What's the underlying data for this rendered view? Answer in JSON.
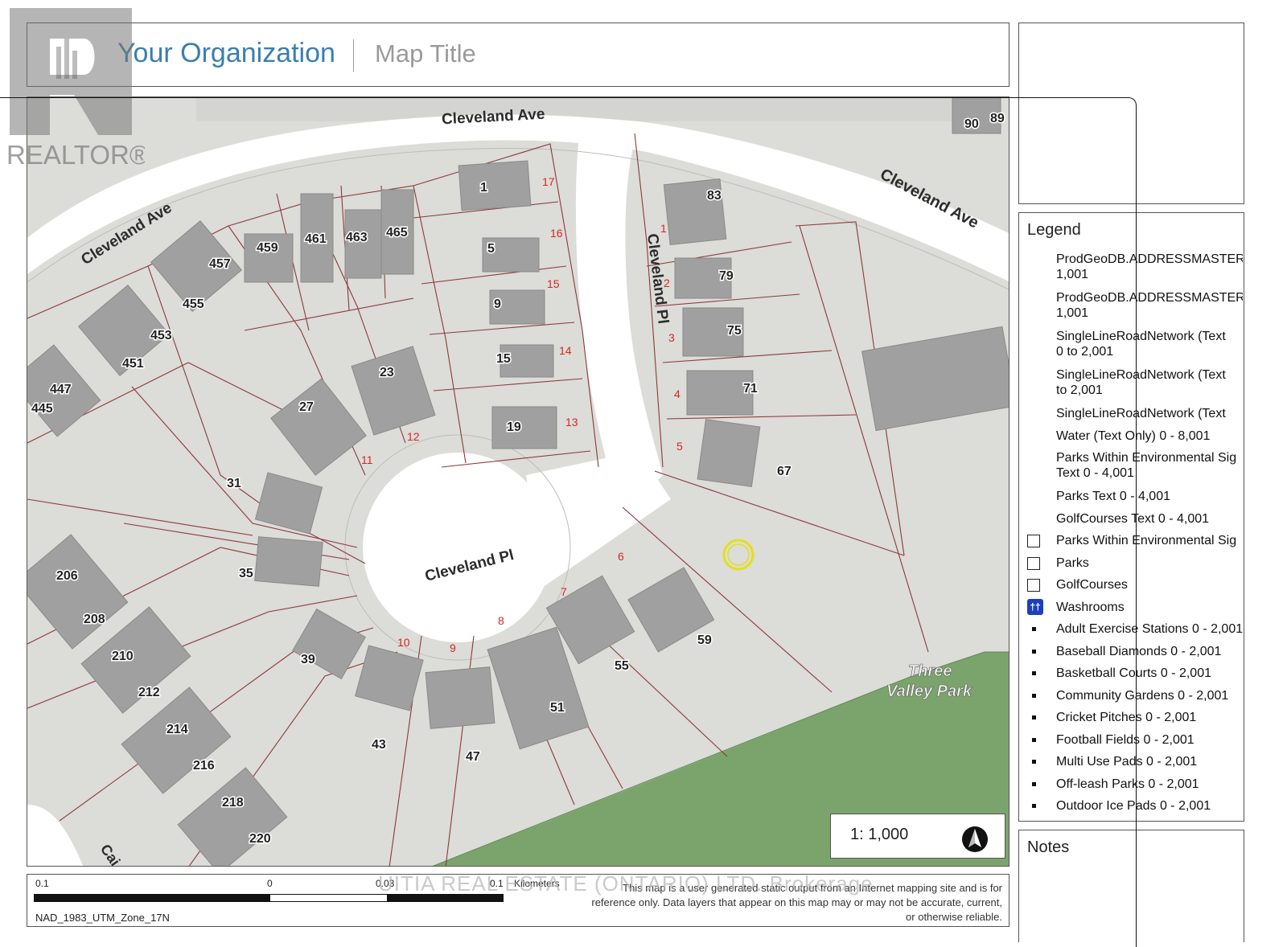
{
  "header": {
    "org_name": "Your Organization",
    "map_title": "Map Title"
  },
  "watermark": {
    "logo_text": "REALTOR®",
    "brokerage": "UITIA REAL ESTATE (ONTARIO) LTD. Brokerage"
  },
  "map": {
    "streets": [
      "Cleveland Ave",
      "Cleveland Ave",
      "Cleveland Ave",
      "Cleveland Pl",
      "Cleveland Pl",
      "Cai"
    ],
    "park_name": [
      "Three",
      "Valley Park"
    ],
    "addresses": [
      "1",
      "5",
      "9",
      "15",
      "19",
      "23",
      "27",
      "31",
      "35",
      "39",
      "43",
      "47",
      "51",
      "55",
      "59",
      "67",
      "71",
      "75",
      "79",
      "83",
      "90",
      "89",
      "206",
      "208",
      "210",
      "212",
      "214",
      "216",
      "218",
      "220",
      "445",
      "447",
      "451",
      "453",
      "455",
      "457",
      "459",
      "461",
      "463",
      "465"
    ],
    "lot_numbers": [
      "1",
      "2",
      "3",
      "4",
      "5",
      "6",
      "7",
      "8",
      "9",
      "10",
      "11",
      "12",
      "13",
      "14",
      "15",
      "16",
      "17",
      "1",
      "2",
      "3",
      "4",
      "5"
    ],
    "accent_color": "#e3e01a",
    "park_color": "#7ba46c"
  },
  "scale": {
    "ratio": "1: 1,000"
  },
  "scalebar": {
    "labels": [
      "0.1",
      "0",
      "0.03",
      "0.1",
      "Kilometers"
    ],
    "projection": "NAD_1983_UTM_Zone_17N"
  },
  "disclaimer": "This map is a user generated static output from an Internet mapping site and is for reference only. Data layers that appear on this map may or may not be accurate, current, or otherwise reliable.",
  "legend": {
    "title": "Legend",
    "items": [
      {
        "label": "ProdGeoDB.ADDRESSMASTER",
        "sub": "1,001",
        "symbol": "none"
      },
      {
        "label": "ProdGeoDB.ADDRESSMASTER",
        "sub": "1,001",
        "symbol": "none"
      },
      {
        "label": "SingleLineRoadNetwork (Text",
        "sub": "0 to 2,001",
        "symbol": "none"
      },
      {
        "label": "SingleLineRoadNetwork (Text",
        "sub": "to 2,001",
        "symbol": "none"
      },
      {
        "label": "SingleLineRoadNetwork (Text",
        "sub": "",
        "symbol": "none"
      },
      {
        "label": "Water (Text Only) 0 - 8,001",
        "sub": "",
        "symbol": "none"
      },
      {
        "label": "Parks Within Environmental Sig",
        "sub": "Text  0 - 4,001",
        "symbol": "none"
      },
      {
        "label": "Parks Text  0 - 4,001",
        "sub": "",
        "symbol": "none"
      },
      {
        "label": "GolfCourses Text  0 - 4,001",
        "sub": "",
        "symbol": "none"
      },
      {
        "label": "Parks Within Environmental Sig",
        "sub": "",
        "symbol": "checkbox"
      },
      {
        "label": "Parks",
        "sub": "",
        "symbol": "checkbox"
      },
      {
        "label": "GolfCourses",
        "sub": "",
        "symbol": "checkbox"
      },
      {
        "label": "Washrooms",
        "sub": "",
        "symbol": "washroom"
      },
      {
        "label": "Adult Exercise Stations 0 - 2,001",
        "sub": "",
        "symbol": "bullet"
      },
      {
        "label": "Baseball Diamonds 0 - 2,001",
        "sub": "",
        "symbol": "bullet"
      },
      {
        "label": "Basketball Courts 0 - 2,001",
        "sub": "",
        "symbol": "bullet"
      },
      {
        "label": "Community Gardens 0 - 2,001",
        "sub": "",
        "symbol": "bullet"
      },
      {
        "label": "Cricket Pitches 0 - 2,001",
        "sub": "",
        "symbol": "bullet"
      },
      {
        "label": "Football Fields 0 - 2,001",
        "sub": "",
        "symbol": "bullet"
      },
      {
        "label": "Multi Use Pads 0 - 2,001",
        "sub": "",
        "symbol": "bullet"
      },
      {
        "label": "Off-leash Parks 0 - 2,001",
        "sub": "",
        "symbol": "bullet"
      },
      {
        "label": "Outdoor Ice Pads 0 - 2,001",
        "sub": "",
        "symbol": "bullet"
      }
    ]
  },
  "notes": {
    "title": "Notes"
  }
}
